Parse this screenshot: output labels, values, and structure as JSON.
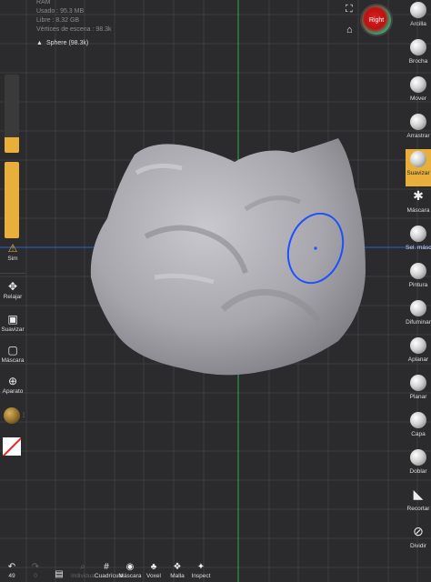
{
  "stats": {
    "ram": "RAM",
    "used": "Usado : 95.3 MB",
    "free": "Libre : 8.32 GB",
    "vertices": "Vértices de escena : 98.3k"
  },
  "scene_item": {
    "label": "Sphere (98.3k)",
    "icon": "triangle-icon"
  },
  "view_cube": {
    "label": "Right"
  },
  "colors": {
    "accent": "#e8b03a",
    "grid": "#3c3c3f",
    "axis_green": "#2faa55",
    "axis_blue": "#2e5fd0",
    "brush_circle": "#1e4fff"
  },
  "left_panel": {
    "slider_radius_fraction": 0.2,
    "slider_intensity_fraction": 1.0,
    "sym_label": "Sim",
    "buttons": [
      {
        "icon": "move-arrows-icon",
        "label": "Relajar"
      },
      {
        "icon": "smooth-box-icon",
        "label": "Suavizar"
      },
      {
        "icon": "mask-box-icon",
        "label": "Máscara"
      },
      {
        "icon": "gizmo-icon",
        "label": "Aparato"
      }
    ]
  },
  "right_tools": [
    {
      "label": "Arcilla",
      "icon": "clay-brush-icon",
      "active": false
    },
    {
      "label": "Brocha",
      "icon": "brush-icon",
      "active": false
    },
    {
      "label": "Mover",
      "icon": "move-brush-icon",
      "active": false
    },
    {
      "label": "Arrastrar",
      "icon": "drag-brush-icon",
      "active": false
    },
    {
      "label": "Suavizar",
      "icon": "smooth-brush-icon",
      "active": true
    },
    {
      "label": "Máscara",
      "icon": "mask-brush-icon",
      "active": false
    },
    {
      "label": "Sel. máscara",
      "icon": "select-mask-icon",
      "active": false
    },
    {
      "label": "Pintura",
      "icon": "paint-brush-icon",
      "active": false
    },
    {
      "label": "Difuminar",
      "icon": "smudge-brush-icon",
      "active": false
    },
    {
      "label": "Aplanar",
      "icon": "flatten-brush-icon",
      "active": false
    },
    {
      "label": "Planar",
      "icon": "planar-brush-icon",
      "active": false
    },
    {
      "label": "Capa",
      "icon": "layer-brush-icon",
      "active": false
    },
    {
      "label": "Doblar",
      "icon": "fold-brush-icon",
      "active": false
    },
    {
      "label": "Recortar",
      "icon": "trim-icon",
      "active": false
    },
    {
      "label": "Dividir",
      "icon": "split-icon",
      "active": false
    }
  ],
  "bottom_bar": [
    {
      "icon": "undo-icon",
      "label": "49",
      "dim": false
    },
    {
      "icon": "redo-icon",
      "label": "0",
      "dim": true
    },
    {
      "icon": "files-icon",
      "label": "",
      "dim": false
    },
    {
      "icon": "search-icon",
      "label": "Individual",
      "dim": true
    },
    {
      "icon": "grid-icon",
      "label": "Cuadrícula",
      "dim": false
    },
    {
      "icon": "eye-mask-icon",
      "label": "Máscara",
      "dim": false
    },
    {
      "icon": "voxel-icon",
      "label": "Voxel",
      "dim": false
    },
    {
      "icon": "mesh-icon",
      "label": "Malla",
      "dim": false
    },
    {
      "icon": "inspect-icon",
      "label": "Inspect",
      "dim": false
    }
  ]
}
